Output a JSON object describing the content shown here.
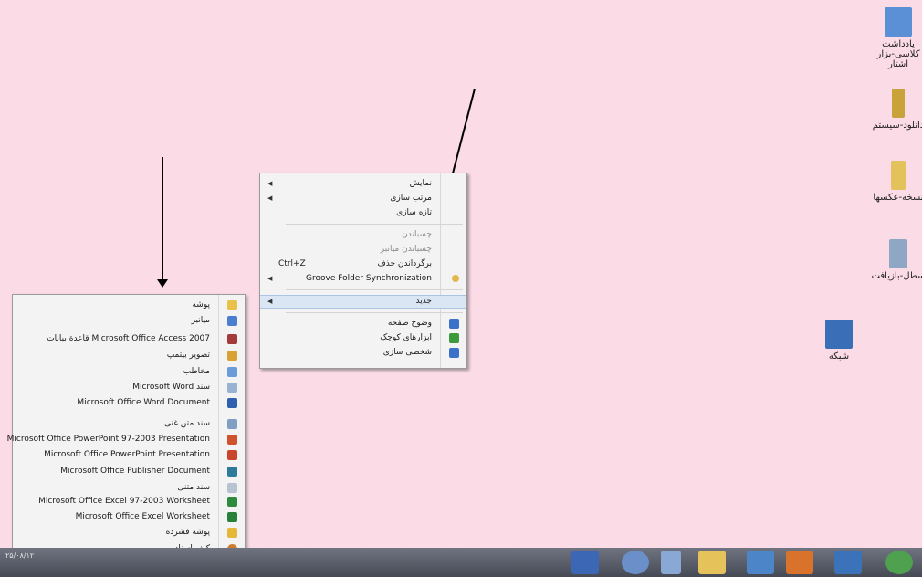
{
  "desktop_icons": [
    {
      "name": "desktop-icon-computer-shortcut",
      "label": "یادداشت\nکلاسی-یزار\nاشتار",
      "color": "#5b8fd6"
    },
    {
      "name": "desktop-icon-notes",
      "label": "دانلود-سیستم",
      "color": "#c9a23a"
    },
    {
      "name": "desktop-icon-folder",
      "label": "نسخه-عکسها",
      "color": "#e3c25c"
    },
    {
      "name": "desktop-icon-recycle-bin",
      "label": "سطل-بازیافت",
      "color": "#8da7c4"
    },
    {
      "name": "desktop-icon-network",
      "label": "شبکه",
      "color": "#3a6fb8"
    }
  ],
  "context_menu": {
    "items": [
      {
        "label": "نمایش",
        "submenu": true
      },
      {
        "label": "مرتب سازی",
        "submenu": true
      },
      {
        "label": "تازه سازی"
      },
      {
        "label": "چسباندن",
        "disabled": true
      },
      {
        "label": "چسباندن میانبر",
        "disabled": true
      },
      {
        "label": "برگرداندن حذف",
        "shortcut": "Ctrl+Z"
      },
      {
        "label": "Groove Folder Synchronization",
        "submenu": true
      },
      {
        "label": "جدید",
        "submenu": true,
        "highlighted": true
      },
      {
        "label": "وضوح صفحه",
        "icon_color": "#3a72c9"
      },
      {
        "label": "ابزارهای کوچک",
        "icon_color": "#3c9a3c"
      },
      {
        "label": "شخصی سازی",
        "icon_color": "#3a72c9"
      }
    ]
  },
  "new_submenu": {
    "items": [
      {
        "label": "پوشه",
        "icon_color": "#e8c04a"
      },
      {
        "label": "میانبر",
        "icon_color": "#4a7fd0"
      },
      {
        "label": "Microsoft Office Access 2007 قاعدة بيانات",
        "icon_color": "#a43b3b"
      },
      {
        "label": "تصویر بیتمپ",
        "icon_color": "#d9a133"
      },
      {
        "label": "مخاطب",
        "icon_color": "#6b9bd8"
      },
      {
        "label": "سند Microsoft Word",
        "icon_color": "#9ab2d1"
      },
      {
        "label": "Microsoft Office Word Document",
        "icon_color": "#2f5fb0"
      },
      {
        "label": "سند متن غنی",
        "icon_color": "#7f9fc4"
      },
      {
        "label": "Microsoft Office PowerPoint 97-2003 Presentation",
        "icon_color": "#d0532d"
      },
      {
        "label": "Microsoft Office PowerPoint Presentation",
        "icon_color": "#c7462c"
      },
      {
        "label": "Microsoft Office Publisher Document",
        "icon_color": "#2d7a9a"
      },
      {
        "label": "سند متنی",
        "icon_color": "#b8c4d2"
      },
      {
        "label": "Microsoft Office Excel 97-2003 Worksheet",
        "icon_color": "#2e8a3e"
      },
      {
        "label": "Microsoft Office Excel Worksheet",
        "icon_color": "#28803a"
      },
      {
        "label": "پوشه فشرده",
        "icon_color": "#e6b83a"
      },
      {
        "label": "کیف اسناد",
        "icon_color": "#cf7b2c"
      }
    ]
  },
  "taskbar": {
    "clock": "۲۵/۰۸/۱۲",
    "buttons": [
      {
        "name": "taskbar-powerpoint-icon",
        "color": "#3b67b5"
      },
      {
        "name": "taskbar-help-icon",
        "color": "#6a8fc9"
      },
      {
        "name": "taskbar-document-icon",
        "color": "#8aa8d4"
      },
      {
        "name": "taskbar-explorer-icon",
        "color": "#e5c25a"
      },
      {
        "name": "taskbar-network-icon",
        "color": "#4c86c9"
      },
      {
        "name": "taskbar-media-player-icon",
        "color": "#d9732c"
      },
      {
        "name": "taskbar-browser-icon",
        "color": "#3a73b9"
      },
      {
        "name": "taskbar-start-icon",
        "color": "#4fa04f"
      }
    ]
  }
}
